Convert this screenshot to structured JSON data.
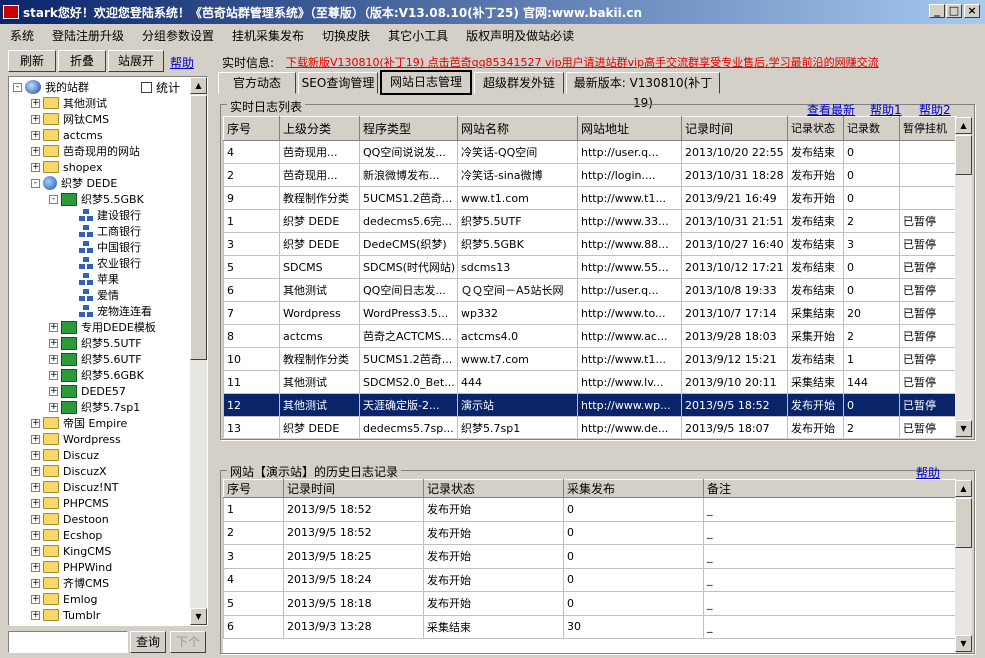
{
  "window": {
    "title": "stark您好！欢迎您登陆系统！《芭奇站群管理系统》（至尊版）（版本:V13.08.10(补丁25) 官网:www.bakii.cn",
    "min": "_",
    "max": "□",
    "close": "×"
  },
  "menu": [
    "系统",
    "登陆注册升级",
    "分组参数设置",
    "挂机采集发布",
    "切换皮肤",
    "其它小工具",
    "版权声明及做站必读"
  ],
  "toolbar": {
    "refresh": "刷新",
    "collapse": "折叠",
    "expand": "站展开",
    "help": "帮助",
    "stats": "统计"
  },
  "realtime": {
    "label": "实时信息:",
    "text": "下载新版V130810(补丁19) 点击芭奇qq85341527  vip用户请进站群vip高手交流群享受专业售后,学习最前沿的网赚交流"
  },
  "tabs": [
    "官方动态",
    "SEO查询管理",
    "网站日志管理",
    "超级群发外链",
    "最新版本: V130810(补丁19)"
  ],
  "tree": [
    {
      "label": "我的站群",
      "level": 0,
      "icon": "network",
      "exp": "-"
    },
    {
      "label": "其他测试",
      "level": 1,
      "icon": "folder",
      "exp": "+"
    },
    {
      "label": "网钛CMS",
      "level": 1,
      "icon": "folder",
      "exp": "+"
    },
    {
      "label": "actcms",
      "level": 1,
      "icon": "folder",
      "exp": "+"
    },
    {
      "label": "芭奇现用的网站",
      "level": 1,
      "icon": "folder",
      "exp": "+"
    },
    {
      "label": "shopex",
      "level": 1,
      "icon": "folder",
      "exp": "+"
    },
    {
      "label": "织梦 DEDE",
      "level": 1,
      "icon": "globe",
      "exp": "-"
    },
    {
      "label": "织梦5.5GBK",
      "level": 2,
      "icon": "green",
      "exp": "-"
    },
    {
      "label": "建设银行",
      "level": 3,
      "icon": "net",
      "exp": ""
    },
    {
      "label": "工商银行",
      "level": 3,
      "icon": "net",
      "exp": ""
    },
    {
      "label": "中国银行",
      "level": 3,
      "icon": "net",
      "exp": ""
    },
    {
      "label": "农业银行",
      "level": 3,
      "icon": "net",
      "exp": ""
    },
    {
      "label": "苹果",
      "level": 3,
      "icon": "net",
      "exp": ""
    },
    {
      "label": "爱情",
      "level": 3,
      "icon": "net",
      "exp": ""
    },
    {
      "label": "宠物连连看",
      "level": 3,
      "icon": "net",
      "exp": ""
    },
    {
      "label": "专用DEDE模板",
      "level": 2,
      "icon": "green",
      "exp": "+"
    },
    {
      "label": "织梦5.5UTF",
      "level": 2,
      "icon": "green",
      "exp": "+"
    },
    {
      "label": "织梦5.6UTF",
      "level": 2,
      "icon": "green",
      "exp": "+"
    },
    {
      "label": "织梦5.6GBK",
      "level": 2,
      "icon": "green",
      "exp": "+"
    },
    {
      "label": "DEDE57",
      "level": 2,
      "icon": "green",
      "exp": "+"
    },
    {
      "label": "织梦5.7sp1",
      "level": 2,
      "icon": "green",
      "exp": "+"
    },
    {
      "label": "帝国 Empire",
      "level": 1,
      "icon": "folder",
      "exp": "+"
    },
    {
      "label": "Wordpress",
      "level": 1,
      "icon": "folder",
      "exp": "+"
    },
    {
      "label": "Discuz",
      "level": 1,
      "icon": "folder",
      "exp": "+"
    },
    {
      "label": "DiscuzX",
      "level": 1,
      "icon": "folder",
      "exp": "+"
    },
    {
      "label": "Discuz!NT",
      "level": 1,
      "icon": "folder",
      "exp": "+"
    },
    {
      "label": "PHPCMS",
      "level": 1,
      "icon": "folder",
      "exp": "+"
    },
    {
      "label": "Destoon",
      "level": 1,
      "icon": "folder",
      "exp": "+"
    },
    {
      "label": "Ecshop",
      "level": 1,
      "icon": "folder",
      "exp": "+"
    },
    {
      "label": "KingCMS",
      "level": 1,
      "icon": "folder",
      "exp": "+"
    },
    {
      "label": "PHPWind",
      "level": 1,
      "icon": "folder",
      "exp": "+"
    },
    {
      "label": "齐博CMS",
      "level": 1,
      "icon": "folder",
      "exp": "+"
    },
    {
      "label": "Emlog",
      "level": 1,
      "icon": "folder",
      "exp": "+"
    },
    {
      "label": "Tumblr",
      "level": 1,
      "icon": "folder",
      "exp": "+"
    }
  ],
  "search": {
    "value": "",
    "button": "查询",
    "next": "下个"
  },
  "log_panel": {
    "title": "实时日志列表",
    "view_latest": "查看最新",
    "help1": "帮助1",
    "help2": "帮助2",
    "columns": [
      "序号",
      "上级分类",
      "程序类型",
      "网站名称",
      "网站地址",
      "记录时间",
      "记录状态",
      "记录数",
      "暂停挂机"
    ],
    "rows": [
      [
        "4",
        "芭奇现用...",
        "QQ空间说说发...",
        "冷笑话-QQ空间",
        "http://user.q...",
        "2013/10/20 22:55",
        "发布结束",
        "0",
        ""
      ],
      [
        "2",
        "芭奇现用...",
        "新浪微博发布...",
        "冷笑话-sina微博",
        "http://login....",
        "2013/10/31 18:28",
        "发布开始",
        "0",
        ""
      ],
      [
        "9",
        "教程制作分类",
        "5UCMS1.2芭奇...",
        "www.t1.com",
        "http://www.t1...",
        "2013/9/21 16:49",
        "发布开始",
        "0",
        ""
      ],
      [
        "1",
        "织梦 DEDE",
        "dedecms5.6完...",
        "织梦5.5UTF",
        "http://www.33...",
        "2013/10/31 21:51",
        "发布结束",
        "2",
        "已暂停"
      ],
      [
        "3",
        "织梦 DEDE",
        "DedeCMS(织梦)",
        "织梦5.5GBK",
        "http://www.88...",
        "2013/10/27 16:40",
        "发布结束",
        "3",
        "已暂停"
      ],
      [
        "5",
        "SDCMS",
        "SDCMS(时代网站)",
        "sdcms13",
        "http://www.55...",
        "2013/10/12 17:21",
        "发布结束",
        "0",
        "已暂停"
      ],
      [
        "6",
        "其他测试",
        "QQ空间日志发...",
        "ＱＱ空间－A5站长网",
        "http://user.q...",
        "2013/10/8 19:33",
        "发布结束",
        "0",
        "已暂停"
      ],
      [
        "7",
        "Wordpress",
        "WordPress3.5...",
        "wp332",
        "http://www.to...",
        "2013/10/7 17:14",
        "采集结束",
        "20",
        "已暂停"
      ],
      [
        "8",
        "actcms",
        "芭奇之ACTCMS...",
        "actcms4.0",
        "http://www.ac...",
        "2013/9/28 18:03",
        "采集开始",
        "2",
        "已暂停"
      ],
      [
        "10",
        "教程制作分类",
        "5UCMS1.2芭奇...",
        "www.t7.com",
        "http://www.t1...",
        "2013/9/12 15:21",
        "发布结束",
        "1",
        "已暂停"
      ],
      [
        "11",
        "其他测试",
        "SDCMS2.0_Bet...",
        "444",
        "http://www.lv...",
        "2013/9/10 20:11",
        "采集结束",
        "144",
        "已暂停"
      ],
      [
        "12",
        "其他测试",
        "天涯确定版-2...",
        "演示站",
        "http://www.wp...",
        "2013/9/5 18:52",
        "发布开始",
        "0",
        "已暂停"
      ],
      [
        "13",
        "织梦 DEDE",
        "dedecms5.7sp...",
        "织梦5.7sp1",
        "http://www.de...",
        "2013/9/5 18:07",
        "发布开始",
        "2",
        "已暂停"
      ]
    ],
    "selected_index": 11
  },
  "history_panel": {
    "title": "网站【演示站】的历史日志记录",
    "help": "帮助",
    "columns": [
      "序号",
      "记录时间",
      "记录状态",
      "采集发布",
      "备注"
    ],
    "rows": [
      [
        "1",
        "2013/9/5  18:52",
        "发布开始",
        "0",
        "_"
      ],
      [
        "2",
        "2013/9/5  18:52",
        "发布开始",
        "0",
        "_"
      ],
      [
        "3",
        "2013/9/5  18:25",
        "发布开始",
        "0",
        "_"
      ],
      [
        "4",
        "2013/9/5  18:24",
        "发布开始",
        "0",
        "_"
      ],
      [
        "5",
        "2013/9/5  18:18",
        "发布开始",
        "0",
        "_"
      ],
      [
        "6",
        "2013/9/3  13:28",
        "采集结束",
        "30",
        "_"
      ]
    ]
  }
}
